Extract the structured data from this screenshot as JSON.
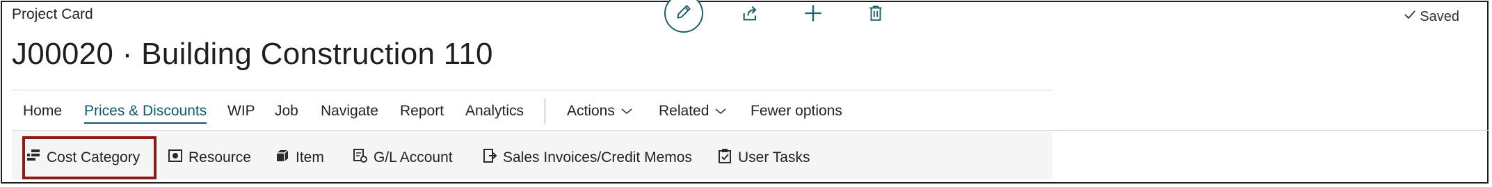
{
  "header": {
    "card_type": "Project Card",
    "title": "J00020 · Building Construction 110",
    "saved_label": "Saved"
  },
  "toolbar": {
    "icons": [
      "edit-icon",
      "share-icon",
      "new-icon",
      "delete-icon"
    ]
  },
  "menu": {
    "items": [
      {
        "label": "Home"
      },
      {
        "label": "Prices & Discounts",
        "active": true
      },
      {
        "label": "WIP"
      },
      {
        "label": "Job"
      },
      {
        "label": "Navigate"
      },
      {
        "label": "Report"
      },
      {
        "label": "Analytics"
      }
    ],
    "actions_label": "Actions",
    "related_label": "Related",
    "fewer_options_label": "Fewer options"
  },
  "subactions": {
    "items": [
      {
        "label": "Cost Category",
        "icon": "cost-category-icon"
      },
      {
        "label": "Resource",
        "icon": "resource-icon"
      },
      {
        "label": "Item",
        "icon": "item-icon"
      },
      {
        "label": "G/L Account",
        "icon": "gl-account-icon"
      },
      {
        "label": "Sales Invoices/Credit Memos",
        "icon": "sales-invoices-icon"
      },
      {
        "label": "User Tasks",
        "icon": "user-tasks-icon"
      }
    ]
  },
  "colors": {
    "accent": "#0e5a6a",
    "highlight_border": "#8b1a1a"
  }
}
